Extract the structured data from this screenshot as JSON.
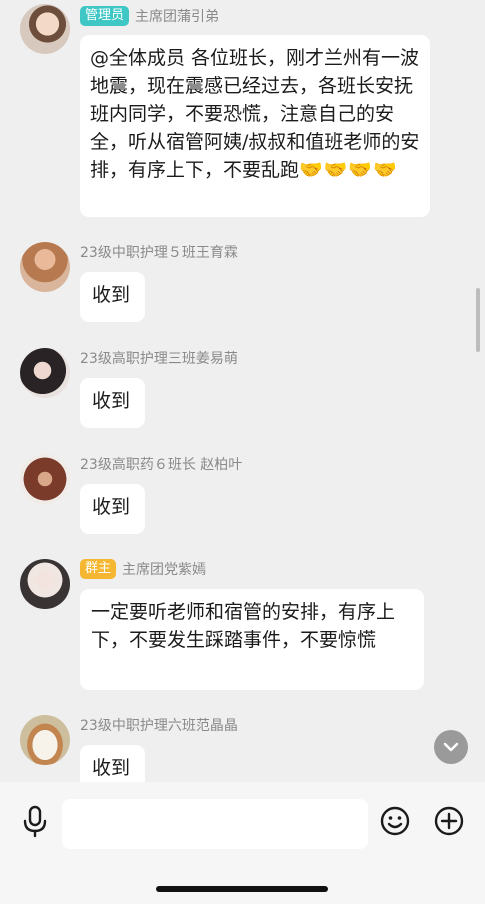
{
  "messages": [
    {
      "badge": "管理员",
      "badge_type": "admin",
      "nick": "主席团蒲引弟",
      "text": "@全体成员 各位班长，刚才兰州有一波地震，现在震感已经过去，各班长安抚班内同学，不要恐慌，注意自己的安全，听从宿管阿姨/叔叔和值班老师的安排，有序上下，不要乱跑",
      "emoji": "🤝🤝🤝🤝"
    },
    {
      "nick": "23级中职护理５班王育霖",
      "text": "收到"
    },
    {
      "nick": "23级高职护理三班姜易萌",
      "text": "收到"
    },
    {
      "nick": "23级高职药６班长 赵柏叶",
      "text": "收到"
    },
    {
      "badge": "群主",
      "badge_type": "owner",
      "nick": "主席团党紫嫣",
      "text": "一定要听老师和宿管的安排，有序上下，不要发生踩踏事件，不要惊慌"
    },
    {
      "nick": "23级中职护理六班范晶晶",
      "text": "收到"
    }
  ],
  "input_bar": {
    "placeholder": ""
  },
  "icons": {
    "voice": "microphone-icon",
    "emoji": "smiley-icon",
    "more": "plus-circle-icon",
    "jump": "chevron-down-icon"
  }
}
